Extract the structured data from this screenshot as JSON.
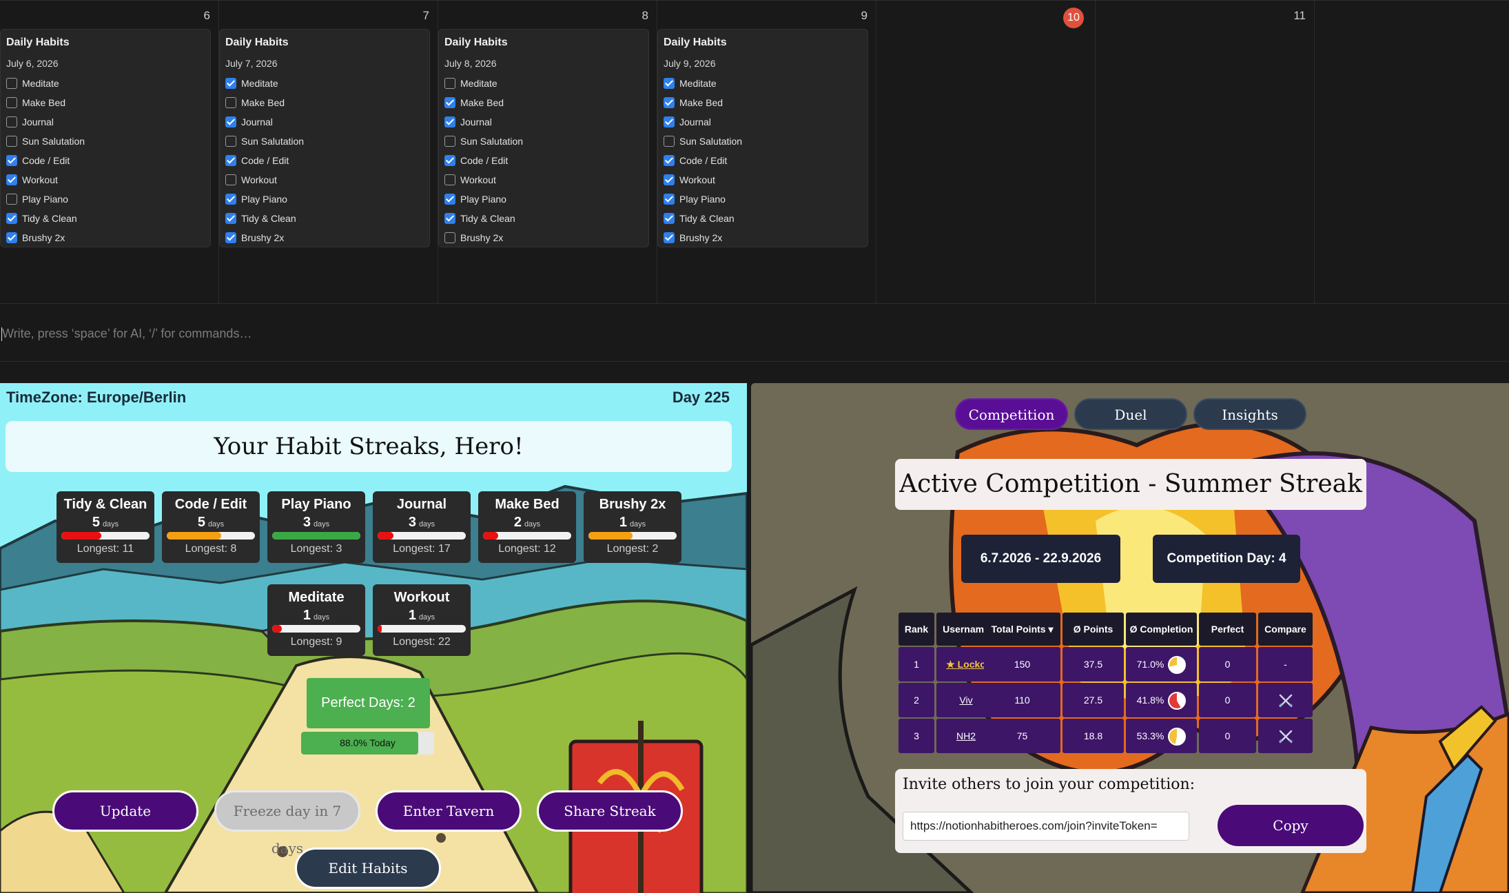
{
  "calendar": {
    "days": [
      {
        "num": "6",
        "today": false,
        "card": {
          "title": "Daily Habits",
          "date": "July 6, 2026",
          "habits": [
            {
              "label": "Meditate",
              "checked": false
            },
            {
              "label": "Make Bed",
              "checked": false
            },
            {
              "label": "Journal",
              "checked": false
            },
            {
              "label": "Sun Salutation",
              "checked": false
            },
            {
              "label": "Code / Edit",
              "checked": true
            },
            {
              "label": "Workout",
              "checked": true
            },
            {
              "label": "Play Piano",
              "checked": false
            },
            {
              "label": "Tidy & Clean",
              "checked": true
            },
            {
              "label": "Brushy 2x",
              "checked": true
            }
          ]
        }
      },
      {
        "num": "7",
        "today": false,
        "card": {
          "title": "Daily Habits",
          "date": "July 7, 2026",
          "habits": [
            {
              "label": "Meditate",
              "checked": true
            },
            {
              "label": "Make Bed",
              "checked": false
            },
            {
              "label": "Journal",
              "checked": true
            },
            {
              "label": "Sun Salutation",
              "checked": false
            },
            {
              "label": "Code / Edit",
              "checked": true
            },
            {
              "label": "Workout",
              "checked": false
            },
            {
              "label": "Play Piano",
              "checked": true
            },
            {
              "label": "Tidy & Clean",
              "checked": true
            },
            {
              "label": "Brushy 2x",
              "checked": true
            }
          ]
        }
      },
      {
        "num": "8",
        "today": false,
        "card": {
          "title": "Daily Habits",
          "date": "July 8, 2026",
          "habits": [
            {
              "label": "Meditate",
              "checked": false
            },
            {
              "label": "Make Bed",
              "checked": true
            },
            {
              "label": "Journal",
              "checked": true
            },
            {
              "label": "Sun Salutation",
              "checked": false
            },
            {
              "label": "Code / Edit",
              "checked": true
            },
            {
              "label": "Workout",
              "checked": false
            },
            {
              "label": "Play Piano",
              "checked": true
            },
            {
              "label": "Tidy & Clean",
              "checked": true
            },
            {
              "label": "Brushy 2x",
              "checked": false
            }
          ]
        }
      },
      {
        "num": "9",
        "today": false,
        "card": {
          "title": "Daily Habits",
          "date": "July 9, 2026",
          "habits": [
            {
              "label": "Meditate",
              "checked": true
            },
            {
              "label": "Make Bed",
              "checked": true
            },
            {
              "label": "Journal",
              "checked": true
            },
            {
              "label": "Sun Salutation",
              "checked": false
            },
            {
              "label": "Code / Edit",
              "checked": true
            },
            {
              "label": "Workout",
              "checked": true
            },
            {
              "label": "Play Piano",
              "checked": true
            },
            {
              "label": "Tidy & Clean",
              "checked": true
            },
            {
              "label": "Brushy 2x",
              "checked": true
            }
          ]
        }
      },
      {
        "num": "10",
        "today": true,
        "card": null
      },
      {
        "num": "11",
        "today": false,
        "card": null
      },
      {
        "num": "",
        "today": false,
        "card": null
      }
    ],
    "today_color": "#e0513c",
    "checkbox_color": "#2f80ed"
  },
  "editor": {
    "placeholder": "Write, press ‘space’ for AI, ‘/’ for commands…"
  },
  "streaks": {
    "timezone": "TimeZone: Europe/Berlin",
    "day_counter": "Day 225",
    "title": "Your Habit Streaks, Hero!",
    "days_unit": "days",
    "items": [
      {
        "name": "Tidy & Clean",
        "count": "5",
        "longest": "Longest: 11",
        "progress": 0.45,
        "color": "#e81010"
      },
      {
        "name": "Code / Edit",
        "count": "5",
        "longest": "Longest: 8",
        "progress": 0.62,
        "color": "#f5a012"
      },
      {
        "name": "Play Piano",
        "count": "3",
        "longest": "Longest: 3",
        "progress": 1.0,
        "color": "#3aa845"
      },
      {
        "name": "Journal",
        "count": "3",
        "longest": "Longest: 17",
        "progress": 0.18,
        "color": "#e81010"
      },
      {
        "name": "Make Bed",
        "count": "2",
        "longest": "Longest: 12",
        "progress": 0.17,
        "color": "#e81010"
      },
      {
        "name": "Brushy 2x",
        "count": "1",
        "longest": "Longest: 2",
        "progress": 0.5,
        "color": "#f5a012"
      },
      {
        "name": "Meditate",
        "count": "1",
        "longest": "Longest: 9",
        "progress": 0.11,
        "color": "#e81010"
      },
      {
        "name": "Workout",
        "count": "1",
        "longest": "Longest: 22",
        "progress": 0.05,
        "color": "#e81010"
      }
    ],
    "perfect_days": "Perfect Days: 2",
    "today_progress": 0.88,
    "today_label": "88.0% Today",
    "buttons": {
      "update": "Update",
      "freeze": "Freeze day in 7 days",
      "tavern": "Enter Tavern",
      "share": "Share Streak",
      "edit": "Edit Habits"
    }
  },
  "competition": {
    "tabs": [
      {
        "label": "Competition",
        "active": true
      },
      {
        "label": "Duel",
        "active": false
      },
      {
        "label": "Insights",
        "active": false
      }
    ],
    "title": "Active Competition - Summer Streak",
    "date_range": "6.7.2026 - 22.9.2026",
    "comp_day": "Competition Day: 4",
    "table": {
      "headers": [
        "Rank",
        "Username",
        "Total Points ▾",
        "Ø Points",
        "Ø Completion Rate",
        "Perfect days",
        "Compare"
      ],
      "rows": [
        {
          "rank": "1",
          "username": "★ Locko",
          "total": "150",
          "avg": "37.5",
          "rate": "71.0%",
          "rate_value": 0.71,
          "perfect": "0",
          "compare": "-",
          "self": true
        },
        {
          "rank": "2",
          "username": "Viv",
          "total": "110",
          "avg": "27.5",
          "rate": "41.8%",
          "rate_value": 0.418,
          "perfect": "0",
          "compare": "swords-icon",
          "self": false
        },
        {
          "rank": "3",
          "username": "NH2",
          "total": "75",
          "avg": "18.8",
          "rate": "53.3%",
          "rate_value": 0.533,
          "perfect": "0",
          "compare": "swords-icon",
          "self": false
        }
      ]
    },
    "invite_label": "Invite others to join your competition:",
    "invite_url": "https://notionhabitheroes.com/join?inviteToken=",
    "copy_label": "Copy",
    "accent": "#4a0b78"
  }
}
